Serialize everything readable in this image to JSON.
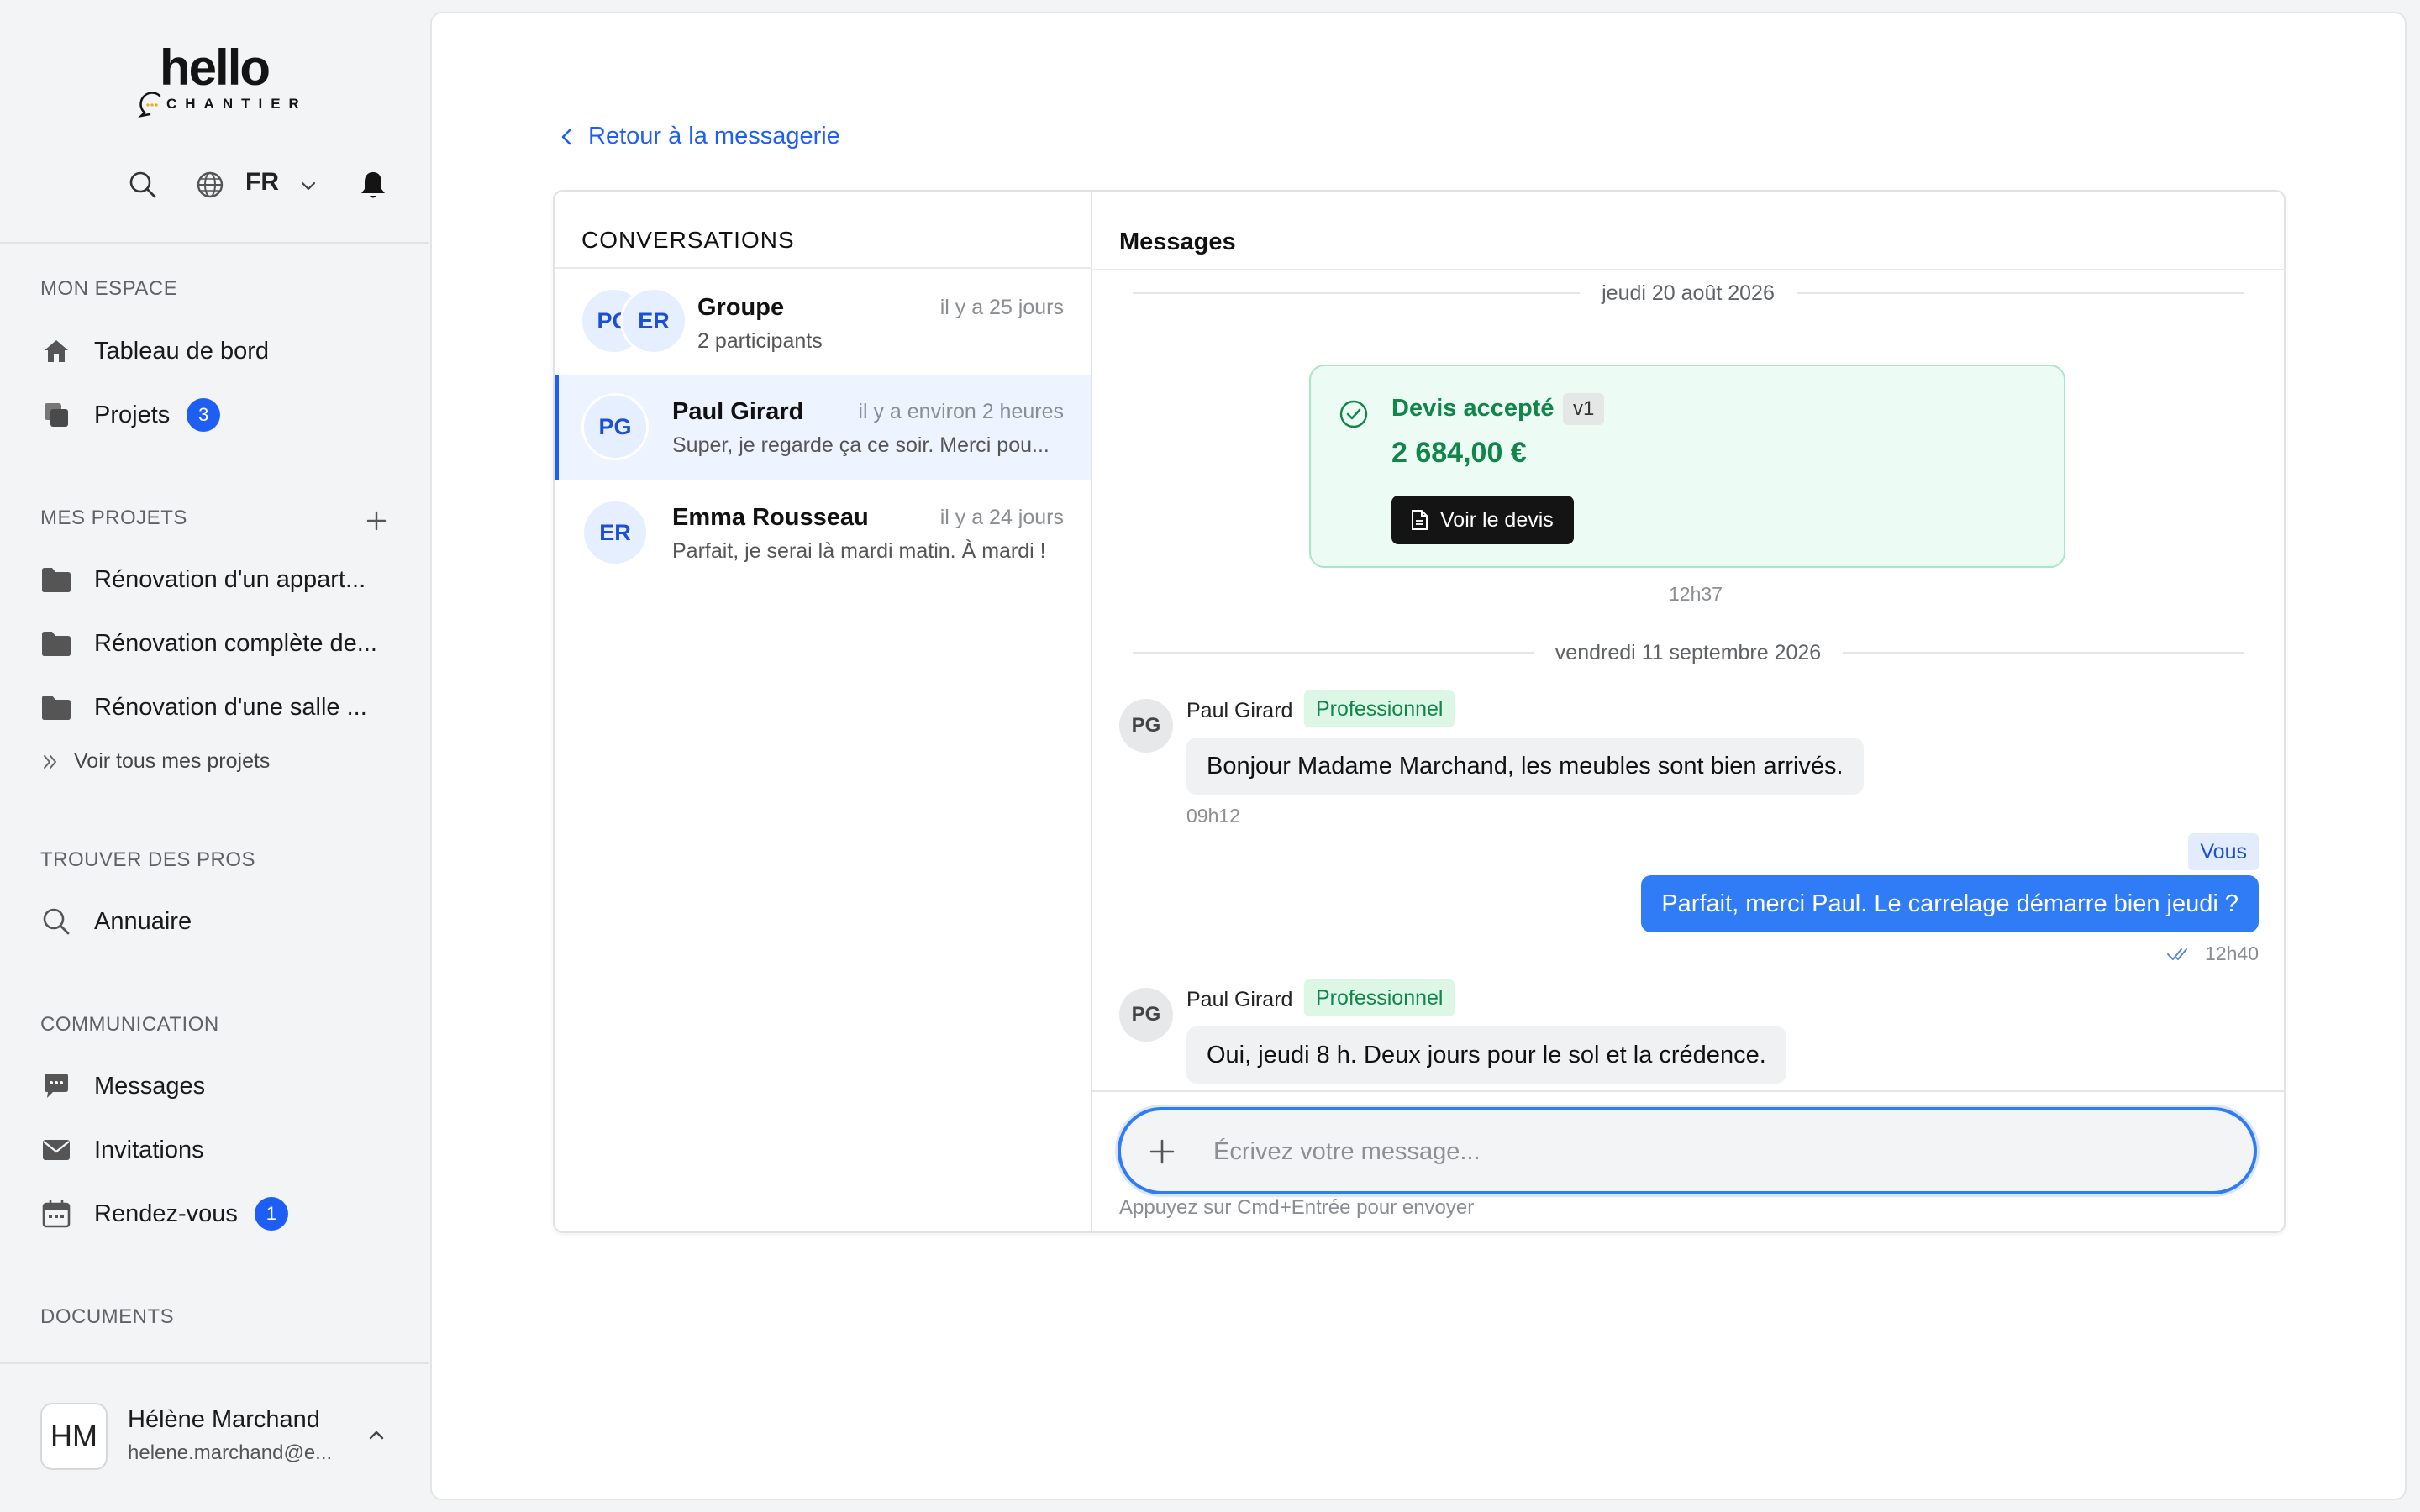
{
  "brand": {
    "name": "hello",
    "sub": "CHANTIER"
  },
  "header": {
    "language": "FR"
  },
  "sidebar": {
    "sections": [
      {
        "label": "MON ESPACE"
      },
      {
        "label": "MES PROJETS"
      },
      {
        "label": "TROUVER DES PROS"
      },
      {
        "label": "COMMUNICATION"
      },
      {
        "label": "DOCUMENTS"
      }
    ],
    "mon_espace": [
      {
        "label": "Tableau de bord",
        "icon": "home-icon"
      },
      {
        "label": "Projets",
        "icon": "copy-icon",
        "badge": "3"
      }
    ],
    "projects": [
      {
        "label": "Rénovation d'un appart..."
      },
      {
        "label": "Rénovation complète de..."
      },
      {
        "label": "Rénovation d'une salle ..."
      }
    ],
    "see_all": "Voir tous mes projets",
    "pros": [
      {
        "label": "Annuaire",
        "icon": "search-icon"
      }
    ],
    "communication": [
      {
        "label": "Messages",
        "icon": "chat-icon"
      },
      {
        "label": "Invitations",
        "icon": "mail-icon"
      },
      {
        "label": "Rendez-vous",
        "icon": "calendar-icon",
        "badge": "1"
      }
    ],
    "user": {
      "initials": "HM",
      "name": "Hélène Marchand",
      "email": "helene.marchand@e..."
    }
  },
  "main": {
    "back_link": "Retour à la messagerie",
    "conversations": {
      "title": "CONVERSATIONS",
      "items": [
        {
          "name": "Groupe",
          "time": "il y a 25 jours",
          "sub": "2 participants",
          "avatars": [
            "PG",
            "ER"
          ]
        },
        {
          "name": "Paul Girard",
          "time": "il y a environ 2 heures",
          "sub": "Super, je regarde ça ce soir. Merci pou...",
          "avatar": "PG",
          "active": true
        },
        {
          "name": "Emma Rousseau",
          "time": "il y a 24 jours",
          "sub": "Parfait, je serai là mardi matin. À mardi !",
          "avatar": "ER"
        }
      ]
    },
    "messages": {
      "title": "Messages",
      "date1": "jeudi 20 août 2026",
      "quote": {
        "status": "Devis accepté",
        "version": "v1",
        "amount": "2 684,00 €",
        "button": "Voir le devis",
        "time": "12h37"
      },
      "date2": "vendredi 11 septembre 2026",
      "thread": [
        {
          "avatar": "PG",
          "sender": "Paul Girard",
          "role": "Professionnel",
          "text": "Bonjour Madame Marchand, les meubles sont bien arrivés.",
          "time": "09h12"
        },
        {
          "from_me": true,
          "tag": "Vous",
          "text": "Parfait, merci Paul. Le carrelage démarre bien jeudi ?",
          "time": "12h40"
        },
        {
          "avatar": "PG",
          "sender": "Paul Girard",
          "role": "Professionnel",
          "text": "Oui, jeudi 8 h. Deux jours pour le sol et la crédence."
        }
      ],
      "composer": {
        "placeholder": "Écrivez votre message...",
        "hint": "Appuyez sur Cmd+Entrée pour envoyer"
      }
    }
  },
  "colors": {
    "accent": "#1f5ef5",
    "success": "#12854a",
    "bubble_out": "#2f7cf6"
  }
}
